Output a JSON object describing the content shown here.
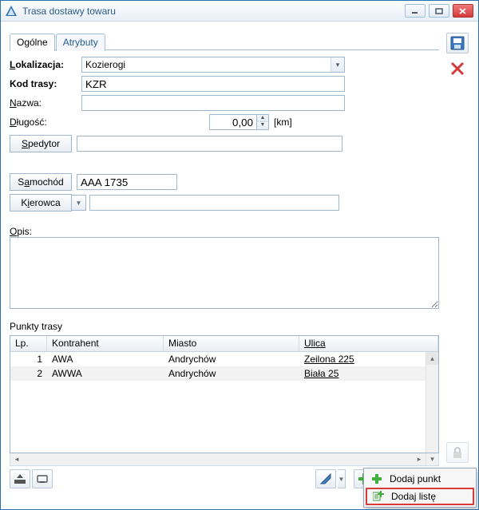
{
  "window": {
    "title": "Trasa dostawy towaru"
  },
  "tabs": {
    "general": "Ogólne",
    "attributes": "Atrybuty"
  },
  "form": {
    "location_label": "Lokalizacja:",
    "location_value": "Kozierogi",
    "route_code_label": "Kod trasy:",
    "route_code_value": "KZR",
    "name_label": "Nazwa:",
    "name_value": "",
    "length_label": "Długość:",
    "length_value": "0,00",
    "length_unit": "[km]",
    "spedytor_btn": "Spedytor",
    "spedytor_value": "",
    "samochod_btn": "Samochód",
    "samochod_value": "AAA 1735",
    "kierowca_btn": "Kierowca",
    "kierowca_value": "",
    "opis_label": "Opis:",
    "opis_value": ""
  },
  "route_points": {
    "heading": "Punkty trasy",
    "columns": {
      "lp": "Lp.",
      "kontrahent": "Kontrahent",
      "miasto": "Miasto",
      "ulica": "Ulica"
    },
    "rows": [
      {
        "lp": "1",
        "kontrahent": "AWA",
        "miasto": "Andrychów",
        "ulica": "Zeilona 225"
      },
      {
        "lp": "2",
        "kontrahent": "AWWA",
        "miasto": "Andrychów",
        "ulica": "Biała 25"
      }
    ]
  },
  "popup": {
    "add_point": "Dodaj punkt",
    "add_list": "Dodaj listę"
  },
  "icons": {
    "save": "save-icon",
    "delete": "delete-icon",
    "lock": "lock-icon"
  }
}
